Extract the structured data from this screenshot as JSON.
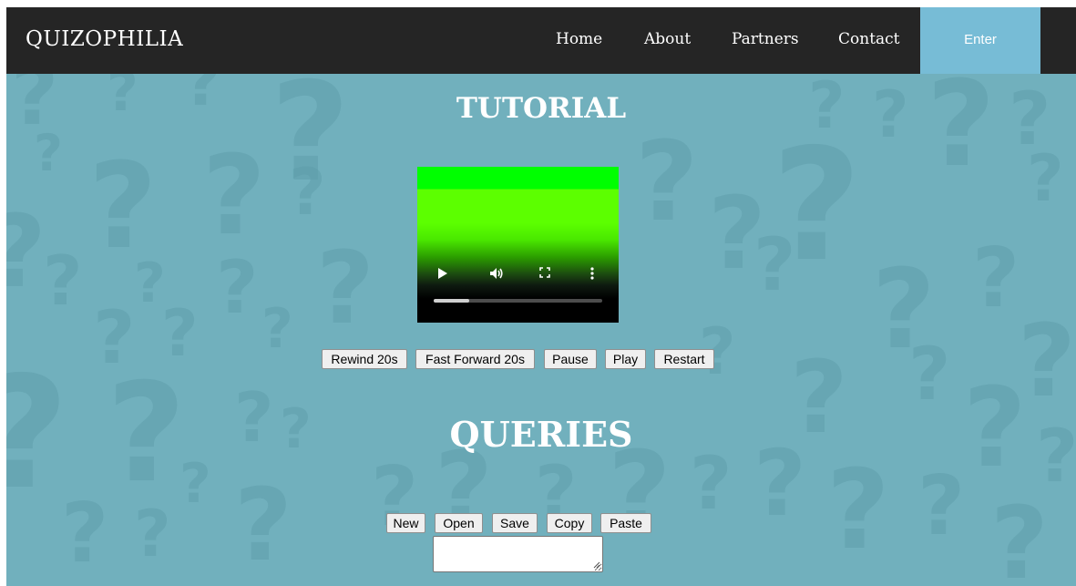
{
  "navbar": {
    "brand": "QUIZOPHILIA",
    "links": [
      {
        "label": "Home"
      },
      {
        "label": "About"
      },
      {
        "label": "Partners"
      },
      {
        "label": "Contact"
      }
    ],
    "enter_label": "Enter"
  },
  "tutorial": {
    "title": "TUTORIAL",
    "video": {
      "icons": [
        "play-icon",
        "volume-icon",
        "fullscreen-icon",
        "more-options-icon"
      ],
      "progress": 0.21
    },
    "controls": [
      {
        "label": "Rewind 20s"
      },
      {
        "label": "Fast Forward 20s"
      },
      {
        "label": "Pause"
      },
      {
        "label": "Play"
      },
      {
        "label": "Restart"
      }
    ]
  },
  "queries": {
    "title": "QUERIES",
    "toolbar": [
      {
        "label": "New"
      },
      {
        "label": "Open"
      },
      {
        "label": "Save"
      },
      {
        "label": "Copy"
      },
      {
        "label": "Paste"
      }
    ],
    "textarea_value": ""
  },
  "colors": {
    "navbar_bg": "#252525",
    "page_bg": "#71b0bd",
    "enter_bg": "#77bcd6",
    "watermark": "#5f9eab"
  }
}
